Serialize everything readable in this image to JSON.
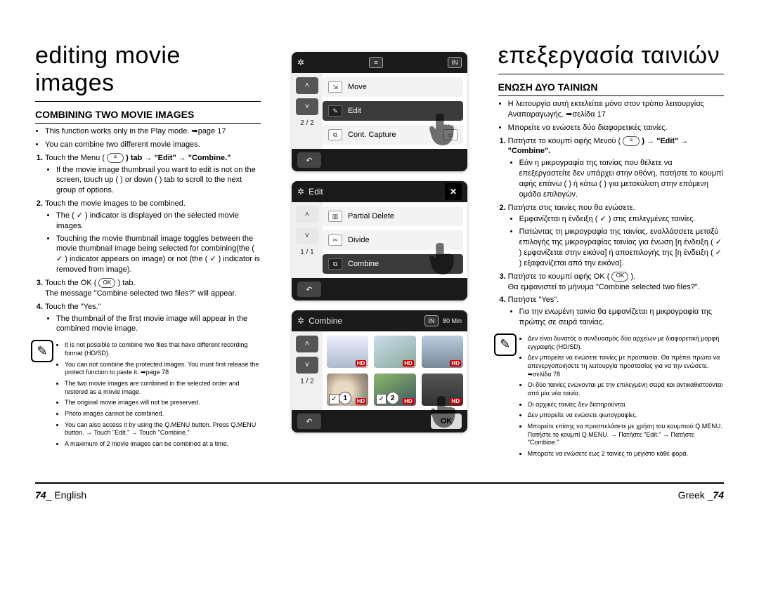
{
  "left": {
    "title": "editing movie images",
    "section": "COMBINING TWO MOVIE IMAGES",
    "intro": [
      "This function works only in the Play mode. ➥page 17",
      "You can combine two different movie images."
    ],
    "steps": [
      {
        "lead": "Touch the Menu ( ",
        "tail": " ) tab → \"Edit\" → \"Combine.\"",
        "sub": [
          "If the movie image thumbnail you want to edit is not on the screen, touch up (  ) or down (  ) tab to scroll to the next group of options."
        ]
      },
      {
        "lead": "Touch the movie images to be combined.",
        "tail": "",
        "sub": [
          "The ( ✓ ) indicator is displayed on the selected movie images.",
          "Touching the movie thumbnail image toggles between the movie thumbnail image being selected for combining(the ( ✓ ) indicator appears on image) or not (the ( ✓ ) indicator is removed from image)."
        ]
      },
      {
        "lead": "Touch the OK ( ",
        "tail": " ) tab.",
        "sub": [
          "The message \"Combine selected two files?\" will appear."
        ],
        "sub_plain": true
      },
      {
        "lead": "Touch the \"Yes.\"",
        "tail": "",
        "sub": [
          "The thumbnail of the first movie image will appear in the combined movie image."
        ],
        "sub_plain": true
      }
    ],
    "notes": [
      "It is not possible to combine two files that have different recording format (HD/SD).",
      "You can not combine the protected images. You must first release the protect function to paste it. ➥page 78",
      "The two movie images are combined in the selected order and restored as a movie image.",
      "The original movie images will not be preserved.",
      "Photo images cannot be combined.",
      "You can also access it by using the Q.MENU button. Press Q.MENU button. → Touch \"Edit.\" → Touch \"Combine.\"",
      "A maximum of 2 movie images can be combined at a time."
    ]
  },
  "right": {
    "title": "επεξεργασία ταινιών",
    "section": "ΕΝΩΣΗ ΔΥΟ ΤΑΙΝΙΩΝ",
    "intro": [
      "Η λειτουργία αυτή εκτελείται μόνο στον τρόπο λειτουργίας Αναπαραγωγής. ➥σελίδα 17",
      "Μπορείτε να ενώσετε δύο διαφορετικές ταινίες."
    ],
    "steps": [
      {
        "lead": "Πατήστε το κουμπί αφής Μενού ( ",
        "tail": " ) → \"Edit\" → \"Combine\".",
        "sub": [
          "Εάν η μικρογραφία της ταινίας που θέλετε να επεξεργαστείτε δεν υπάρχει στην οθόνη, πατήστε το κουμπί αφής επάνω (  ) ή κάτω (  ) για μετακύλιση στην επόμενη ομάδα επιλογών."
        ]
      },
      {
        "lead": "Πατήστε στις ταινίες που θα ενώσετε.",
        "tail": "",
        "sub": [
          "Εμφανίζεται η ένδειξη ( ✓ ) στις επιλεγμένες ταινίες.",
          "Πατώντας τη μικρογραφία της ταινίας, εναλλάσσετε μεταξύ επιλογής της μικρογραφίας ταινίας για ένωση [η ένδειξη ( ✓ ) εμφανίζεται στην εικόνα] ή αποεπιλογής της [η ένδειξη ( ✓ ) εξαφανίζεται από την εικόνα]."
        ]
      },
      {
        "lead": "Πατήστε το κουμπί αφής OK ( ",
        "tail": " ).",
        "sub": [
          "Θα εμφανιστεί το μήνυμα \"Combine selected two files?\"."
        ],
        "sub_plain": true
      },
      {
        "lead": "Πατήστε \"Yes\".",
        "tail": "",
        "sub": [
          "Για την ενωμένη ταινία θα εμφανίζεται η μικρογραφία της πρώτης σε σειρά ταινίας."
        ]
      }
    ],
    "notes": [
      "Δεν είναι δυνατός ο συνδυασμός δύο αρχείων με διαφορετική μορφή εγγραφής (HD/SD).",
      "Δεν μπορείτε να ενώσετε ταινίες με προστασία. Θα πρέπει πρώτα να απενεργοποιήσετε τη λειτουργία προστασίας για να την ενώσετε. ➥σελίδα 78",
      "Οι δύο ταινίες ενώνονται με την επιλεγμένη σειρά και αντικαθιστούνται από μία νέα ταινία.",
      "Οι αρχικές ταινίες δεν διατηρούνται.",
      "Δεν μπορείτε να ενώσετε φωτογραφίες.",
      "Μπορείτε επίσης να προσπελάσετε με χρήση του κουμπιού Q.MENU. Πατήστε το κουμπί Q.MENU. → Πατήστε \"Edit.\" → Πατήστε \"Combine.\"",
      "Μπορείτε να ενώσετε έως 2 ταινίες το μέγιστο κάθε φορά."
    ]
  },
  "screens": {
    "s1": {
      "count": "2 / 2",
      "rows": [
        "Move",
        "Edit",
        "Cont. Capture"
      ],
      "top_icons": [
        "≡",
        "IN"
      ]
    },
    "s2": {
      "title": "Edit",
      "count": "1 / 1",
      "rows": [
        "Partial Delete",
        "Divide",
        "Combine"
      ]
    },
    "s3": {
      "title": "Combine",
      "count": "1 / 2",
      "ok": "OK",
      "badge": "80 Min",
      "in": "IN"
    }
  },
  "footer": {
    "left_num": "74",
    "left_lang": "English",
    "right_lang": "Greek",
    "right_num": "74"
  },
  "glyphs": {
    "menu": "≡",
    "ok": "OK",
    "up": "˄",
    "down": "˅",
    "back": "↶",
    "reel": "✲",
    "pencil": "✎"
  }
}
